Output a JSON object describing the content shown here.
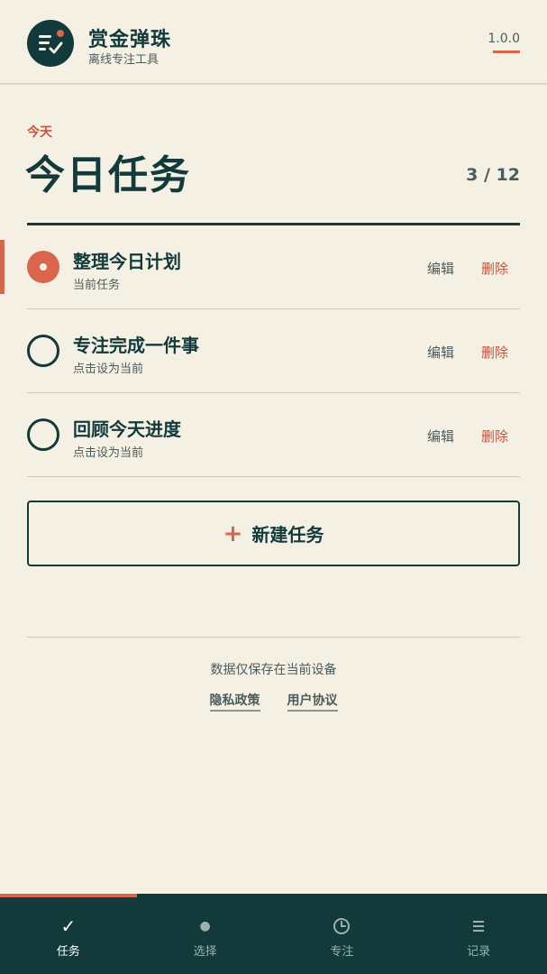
{
  "header": {
    "app_name": "赏金弹珠",
    "app_subtitle": "离线专注工具",
    "version": "1.0.0"
  },
  "main": {
    "eyebrow": "今天",
    "title": "今日任务",
    "counter": "3 / 12"
  },
  "tasks": [
    {
      "title": "整理今日计划",
      "subtitle": "当前任务",
      "edit_label": "编辑",
      "delete_label": "删除",
      "active": true
    },
    {
      "title": "专注完成一件事",
      "subtitle": "点击设为当前",
      "edit_label": "编辑",
      "delete_label": "删除",
      "active": false
    },
    {
      "title": "回顾今天进度",
      "subtitle": "点击设为当前",
      "edit_label": "编辑",
      "delete_label": "删除",
      "active": false
    }
  ],
  "new_task": {
    "plus": "+",
    "label": "新建任务"
  },
  "footer": {
    "note": "数据仅保存在当前设备",
    "privacy_link": "隐私政策",
    "terms_link": "用户协议"
  },
  "nav": {
    "progress_fraction": 0.25,
    "items": [
      {
        "label": "任务",
        "icon": "check-icon",
        "glyph": "✓",
        "active": true
      },
      {
        "label": "选择",
        "icon": "dot-icon",
        "glyph": "●",
        "active": false
      },
      {
        "label": "专注",
        "icon": "clock-icon",
        "glyph": "",
        "active": false
      },
      {
        "label": "记录",
        "icon": "list-icon",
        "glyph": "",
        "active": false
      }
    ]
  },
  "colors": {
    "background": "#f5f0e4",
    "primary": "#123a3a",
    "accent": "#d8654c",
    "danger_text": "#c5533f"
  }
}
